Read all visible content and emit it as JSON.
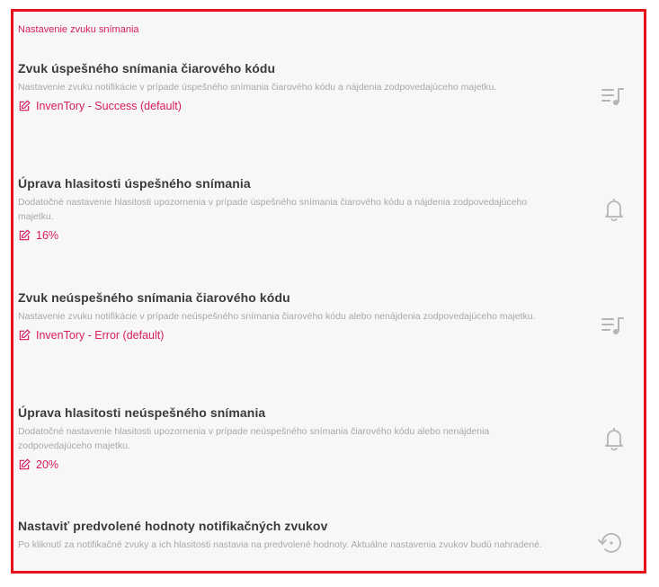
{
  "section": {
    "title": "Nastavenie zvuku snímania"
  },
  "items": [
    {
      "title": "Zvuk úspešného snímania čiarového kódu",
      "description": "Nastavenie zvuku notifikácie v prípade úspešného snímania čiarového kódu a nájdenia zodpovedajúceho majetku.",
      "value": "InvenTory - Success (default)",
      "value_icon": "edit-icon",
      "trailing_icon": "playlist-music-icon"
    },
    {
      "title": "Úprava hlasitosti úspešného snímania",
      "description": "Dodatočné nastavenie hlasitosti upozornenia v prípade úspešného snímania čiarového kódu a nájdenia zodpovedajúceho majetku.",
      "value": "16%",
      "value_icon": "edit-icon",
      "trailing_icon": "bell-icon"
    },
    {
      "title": "Zvuk neúspešného snímania čiarového kódu",
      "description": "Nastavenie zvuku notifikácie v prípade neúspešného snímania čiarového kódu alebo nenájdenia zodpovedajúceho majetku.",
      "value": "InvenTory - Error (default)",
      "value_icon": "edit-icon",
      "trailing_icon": "playlist-music-icon"
    },
    {
      "title": "Úprava hlasitosti neúspešného snímania",
      "description": "Dodatočné nastavenie hlasitosti upozornenia v prípade neúspešného snímania čiarového kódu alebo nenájdenia zodpovedajúceho majetku.",
      "value": "20%",
      "value_icon": "edit-icon",
      "trailing_icon": "bell-icon"
    },
    {
      "title": "Nastaviť predvolené hodnoty notifikačných zvukov",
      "description": "Po kliknutí za notifikačné zvuky a ich hlasitosti nastavia na predvolené hodnoty. Aktuálne nastavenia zvukov budú nahradené.",
      "trailing_icon": "restore-icon"
    }
  ],
  "colors": {
    "accent": "#d81b60",
    "frame_border": "#e8101a",
    "title": "#3a3a3a",
    "description": "#a8a8a8",
    "icon": "#b5b5b5"
  }
}
